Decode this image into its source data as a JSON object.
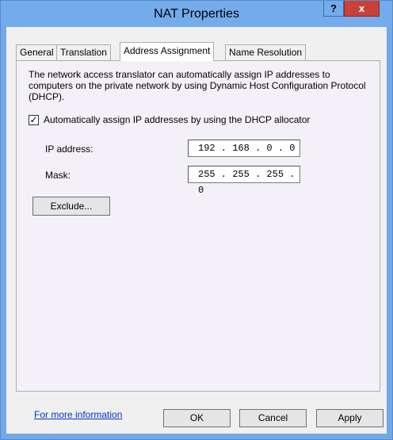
{
  "window": {
    "title": "NAT Properties",
    "help_glyph": "?",
    "close_glyph": "x"
  },
  "tabs": [
    {
      "label": "General",
      "active": false
    },
    {
      "label": "Translation",
      "active": false
    },
    {
      "label": "Address Assignment",
      "active": true
    },
    {
      "label": "Name Resolution",
      "active": false
    }
  ],
  "panel": {
    "description": "The network access translator can automatically assign IP addresses to computers on the private network by using Dynamic Host Configuration Protocol (DHCP).",
    "auto_assign": {
      "label": "Automatically assign IP addresses by using the DHCP allocator",
      "checked": true,
      "check_glyph": "✓"
    },
    "ip_address": {
      "label": "IP address:",
      "value": "192 . 168 .   0 .   0"
    },
    "mask": {
      "label": "Mask:",
      "value": "255 . 255 . 255 .   0"
    },
    "exclude_label": "Exclude..."
  },
  "link": "For more information",
  "footer": {
    "ok_label": "OK",
    "cancel_label": "Cancel",
    "apply_label": "Apply"
  },
  "colors": {
    "titlebar": "#74abec",
    "close_button": "#c7423a",
    "panel_background": "#f4f0f8",
    "link": "#0033cc"
  }
}
